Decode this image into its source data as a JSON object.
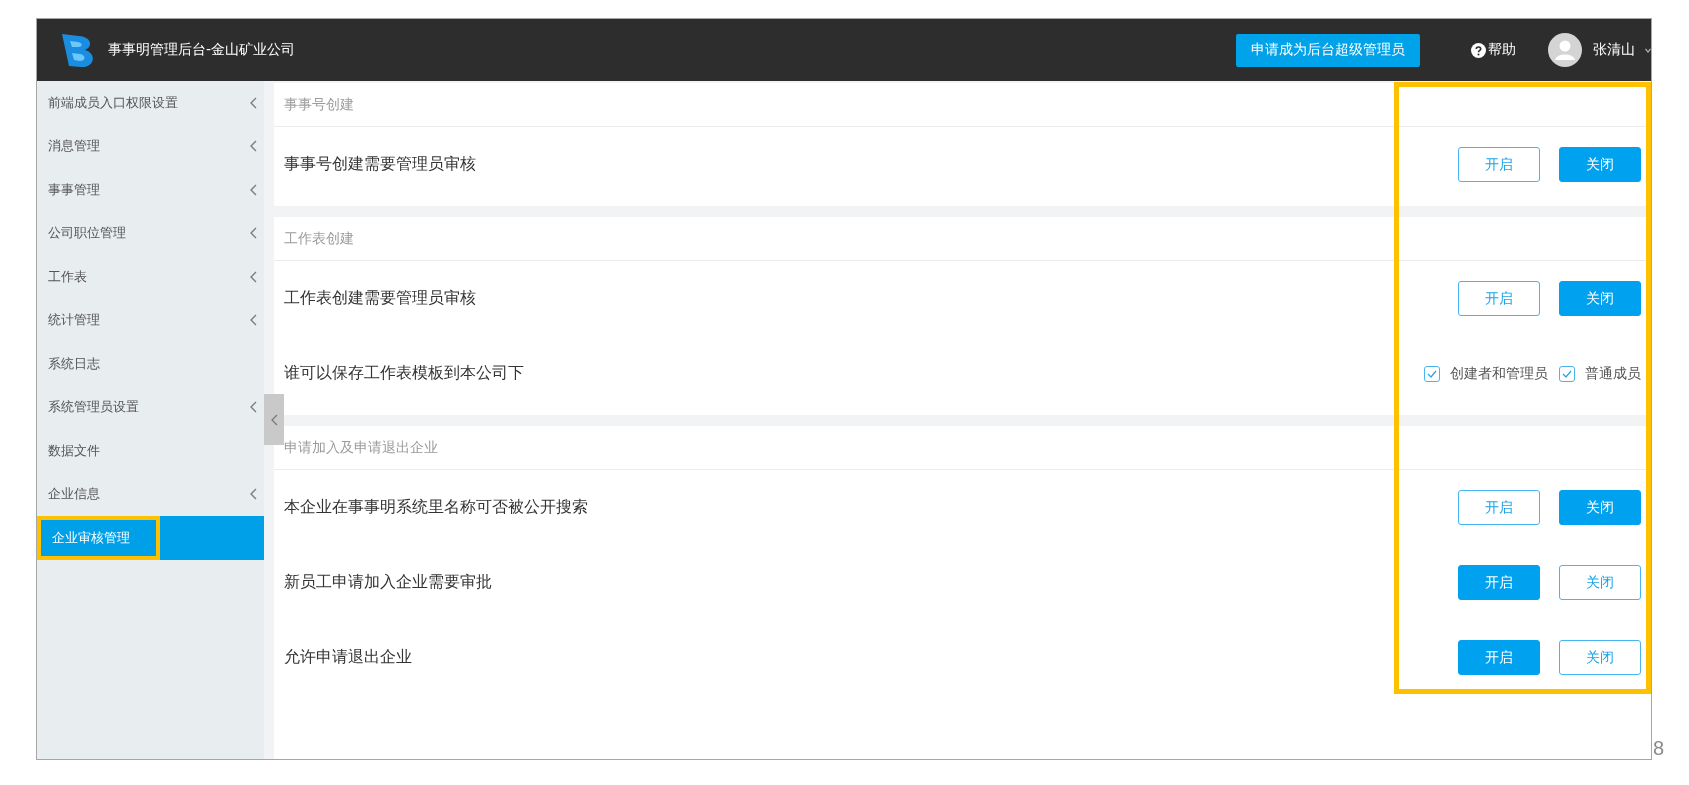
{
  "header": {
    "title": "事事明管理后台-金山矿业公司",
    "apply_button": "申请成为后台超级管理员",
    "help": "帮助",
    "user": {
      "name": "张清山"
    }
  },
  "sidebar": {
    "items": [
      {
        "label": "前端成员入口权限设置",
        "expandable": true,
        "selected": false,
        "highlighted": false
      },
      {
        "label": "消息管理",
        "expandable": true,
        "selected": false,
        "highlighted": false
      },
      {
        "label": "事事管理",
        "expandable": true,
        "selected": false,
        "highlighted": false
      },
      {
        "label": "公司职位管理",
        "expandable": true,
        "selected": false,
        "highlighted": false
      },
      {
        "label": "工作表",
        "expandable": true,
        "selected": false,
        "highlighted": false
      },
      {
        "label": "统计管理",
        "expandable": true,
        "selected": false,
        "highlighted": false
      },
      {
        "label": "系统日志",
        "expandable": false,
        "selected": false,
        "highlighted": false
      },
      {
        "label": "系统管理员设置",
        "expandable": true,
        "selected": false,
        "highlighted": false
      },
      {
        "label": "数据文件",
        "expandable": false,
        "selected": false,
        "highlighted": false
      },
      {
        "label": "企业信息",
        "expandable": true,
        "selected": false,
        "highlighted": false
      },
      {
        "label": "企业审核管理",
        "expandable": false,
        "selected": true,
        "highlighted": true
      }
    ]
  },
  "content": {
    "controls_highlighted": true,
    "sections": [
      {
        "title": "事事号创建",
        "rows": [
          {
            "kind": "toggle",
            "label": "事事号创建需要管理员审核",
            "options": [
              {
                "label": "开启",
                "selected": false
              },
              {
                "label": "关闭",
                "selected": true
              }
            ]
          }
        ]
      },
      {
        "title": "工作表创建",
        "rows": [
          {
            "kind": "toggle",
            "label": "工作表创建需要管理员审核",
            "options": [
              {
                "label": "开启",
                "selected": false
              },
              {
                "label": "关闭",
                "selected": true
              }
            ]
          },
          {
            "kind": "checkboxes",
            "label": "谁可以保存工作表模板到本公司下",
            "options": [
              {
                "label": "创建者和管理员",
                "checked": true
              },
              {
                "label": "普通成员",
                "checked": true
              }
            ]
          }
        ]
      },
      {
        "title": "申请加入及申请退出企业",
        "rows": [
          {
            "kind": "toggle",
            "label": "本企业在事事明系统里名称可否被公开搜索",
            "options": [
              {
                "label": "开启",
                "selected": false
              },
              {
                "label": "关闭",
                "selected": true
              }
            ]
          },
          {
            "kind": "toggle",
            "label": "新员工申请加入企业需要审批",
            "options": [
              {
                "label": "开启",
                "selected": true
              },
              {
                "label": "关闭",
                "selected": false
              }
            ]
          },
          {
            "kind": "toggle",
            "label": "允许申请退出企业",
            "options": [
              {
                "label": "开启",
                "selected": true
              },
              {
                "label": "关闭",
                "selected": false
              }
            ]
          }
        ]
      }
    ]
  },
  "page_number": "8"
}
